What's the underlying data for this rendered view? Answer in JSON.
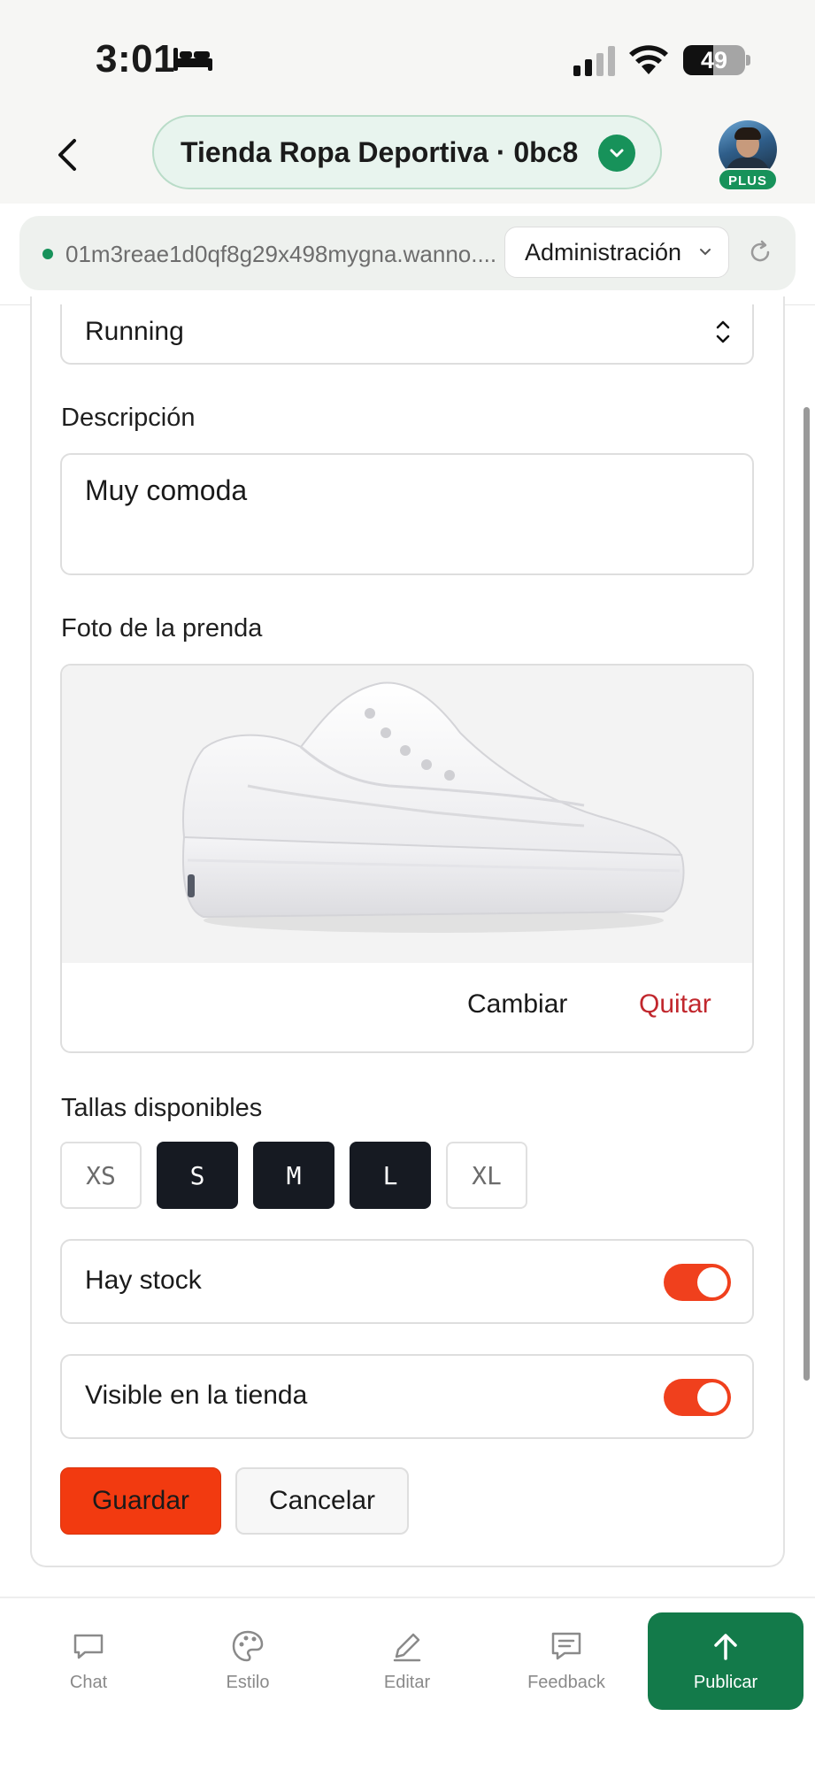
{
  "status_bar": {
    "time": "3:01",
    "battery_level": "49",
    "battery_fraction": 0.49
  },
  "header": {
    "project_name": "Tienda Ropa Deportiva · 0bc8",
    "plan_badge": "PLUS",
    "url": "01m3reae1d0qf8g29x498mygna.wanno....",
    "role_selected": "Administración"
  },
  "form": {
    "category_value": "Running",
    "description_label": "Descripción",
    "description_value": "Muy comoda",
    "photo_label": "Foto de la prenda",
    "photo_change": "Cambiar",
    "photo_remove": "Quitar",
    "sizes_label": "Tallas disponibles",
    "sizes": [
      {
        "label": "XS",
        "selected": false
      },
      {
        "label": "S",
        "selected": true
      },
      {
        "label": "M",
        "selected": true
      },
      {
        "label": "L",
        "selected": true
      },
      {
        "label": "XL",
        "selected": false
      }
    ],
    "stock_label": "Hay stock",
    "stock_on": true,
    "visible_label": "Visible en la tienda",
    "visible_on": true,
    "save_label": "Guardar",
    "cancel_label": "Cancelar"
  },
  "bottom_nav": {
    "chat": "Chat",
    "style": "Estilo",
    "edit": "Editar",
    "feedback": "Feedback",
    "publish": "Publicar"
  },
  "colors": {
    "accent_green": "#17925a",
    "publish_green": "#137a4a",
    "save_orange": "#f23a10",
    "toggle_on": "#f0401d",
    "remove_red": "#c1272d",
    "size_selected": "#161a22"
  }
}
